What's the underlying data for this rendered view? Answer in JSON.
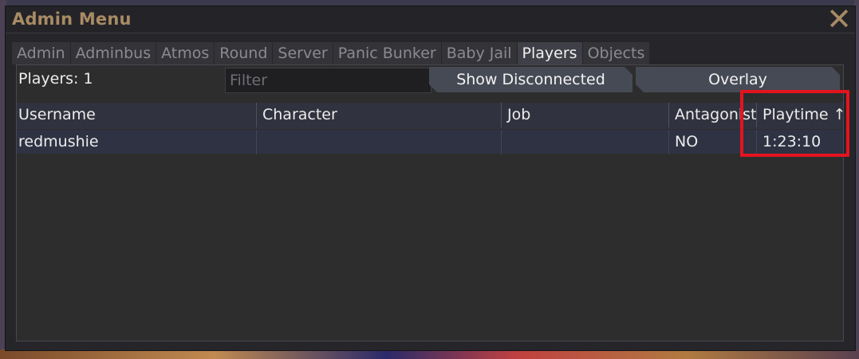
{
  "window": {
    "title": "Admin Menu",
    "close_glyph": "✕"
  },
  "tabs": [
    {
      "label": "Admin"
    },
    {
      "label": "Adminbus"
    },
    {
      "label": "Atmos"
    },
    {
      "label": "Round"
    },
    {
      "label": "Server"
    },
    {
      "label": "Panic Bunker"
    },
    {
      "label": "Baby Jail"
    },
    {
      "label": "Players",
      "active": true
    },
    {
      "label": "Objects"
    }
  ],
  "players_panel": {
    "count_label": "Players: 1",
    "filter_placeholder": "Filter",
    "filter_value": "",
    "show_disconnected_label": "Show Disconnected",
    "overlay_label": "Overlay"
  },
  "table": {
    "columns": [
      "Username",
      "Character",
      "Job",
      "Antagonist",
      "Playtime ↑"
    ],
    "rows": [
      [
        "redmushie",
        "",
        "",
        "NO",
        "1:23:10"
      ]
    ]
  },
  "colors": {
    "title": "#a88b64",
    "active_tab": "#3f3f48",
    "highlight": "#e4141e"
  }
}
